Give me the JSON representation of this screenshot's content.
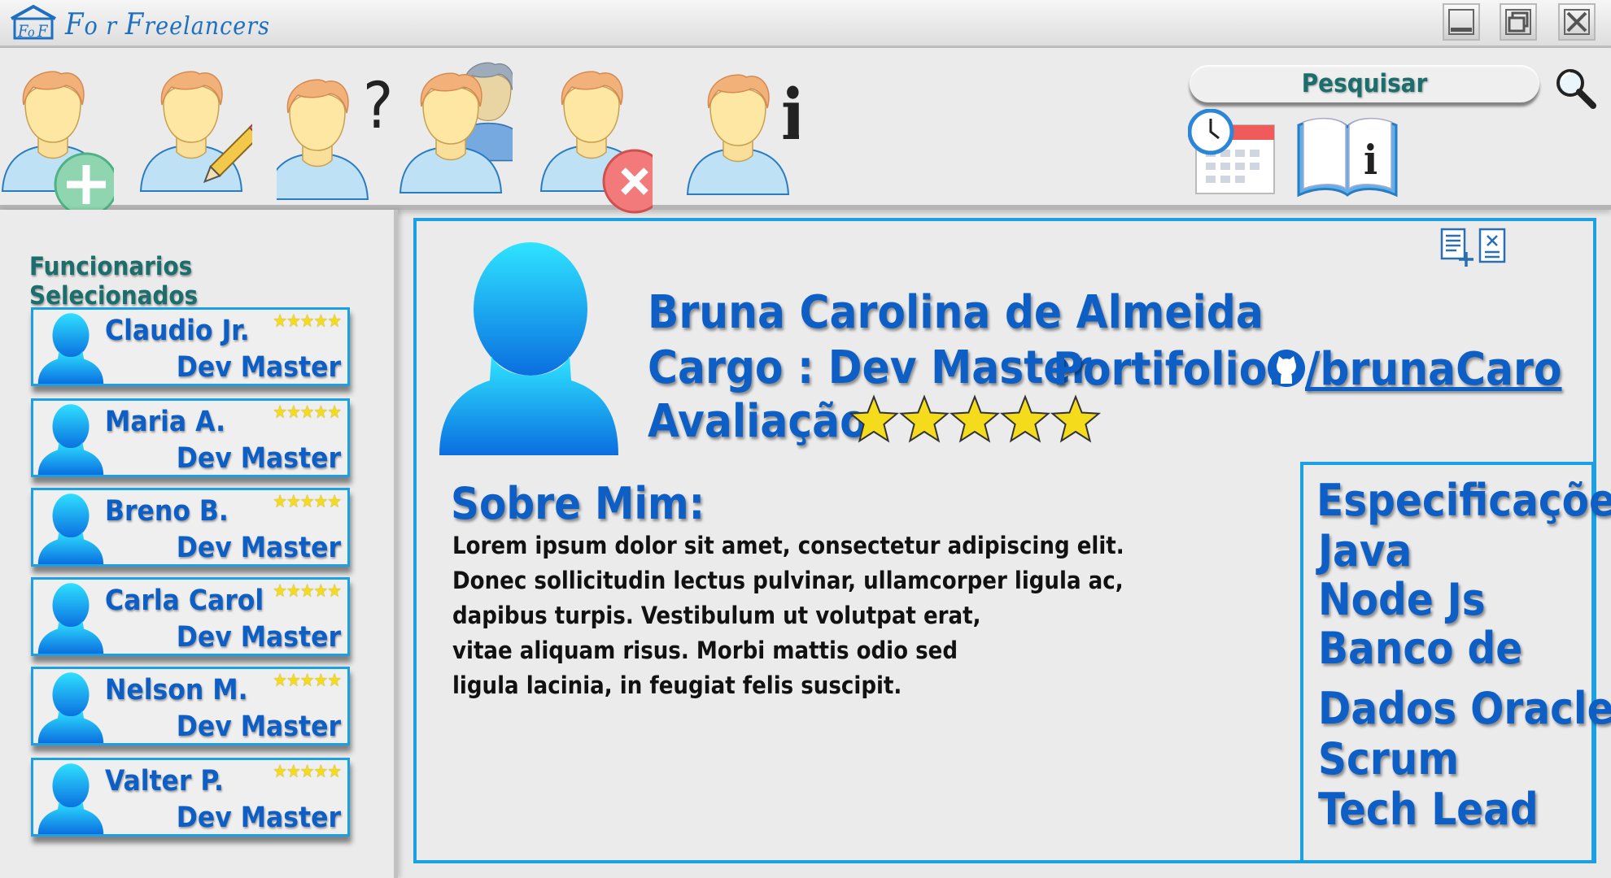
{
  "app": {
    "title_first": "F",
    "title_o": "o",
    "title_r": " r ",
    "title_second": "F",
    "title_rest": "reelancers"
  },
  "window_controls": [
    "minimize",
    "maximize",
    "close"
  ],
  "toolbar": {
    "tools": [
      {
        "name": "add-employee",
        "icon": "user-plus-icon"
      },
      {
        "name": "edit-employee",
        "icon": "user-edit-icon"
      },
      {
        "name": "query-employee",
        "icon": "user-question-icon",
        "glyph": "?"
      },
      {
        "name": "employee-group",
        "icon": "users-group-icon"
      },
      {
        "name": "remove-employee",
        "icon": "user-remove-icon"
      },
      {
        "name": "employee-info",
        "icon": "user-info-icon",
        "glyph": "i"
      }
    ],
    "search_placeholder": "Pesquisar",
    "calendar_icon": "calendar-clock-icon",
    "manual_icon": "book-info-icon"
  },
  "sidebar": {
    "title": "Funcionarios Selecionados",
    "stars": "★★★★★",
    "employees": [
      {
        "name": "Claudio Jr.",
        "role": "Dev Master"
      },
      {
        "name": "Maria A.",
        "role": "Dev Master"
      },
      {
        "name": "Breno B.",
        "role": "Dev Master"
      },
      {
        "name": "Carla Carol",
        "role": "Dev Master"
      },
      {
        "name": "Nelson M.",
        "role": "Dev Master"
      },
      {
        "name": "Valter P.",
        "role": "Dev Master"
      }
    ]
  },
  "profile": {
    "name": "Bruna Carolina de Almeida",
    "cargo_label": "Cargo : Dev Master",
    "portfolio_label": "Portifolio:",
    "portfolio_link": "/brunaCaro",
    "rating_label": "Avaliação",
    "rating_value": 5,
    "about_title": "Sobre Mim:",
    "about_lines": [
      "Lorem ipsum dolor sit amet, consectetur adipiscing elit.",
      "Donec sollicitudin lectus pulvinar, ullamcorper ligula ac,",
      "dapibus turpis. Vestibulum ut volutpat erat,",
      "vitae aliquam risus. Morbi mattis odio sed",
      "ligula lacinia, in feugiat felis suscipit."
    ],
    "specs_title": "Especificações",
    "specs": [
      "Java",
      "Node Js",
      "Banco de",
      "Dados Oracle",
      "Scrum",
      "Tech Lead"
    ]
  },
  "colors": {
    "accent_blue": "#1aa0e3",
    "text_blue": "#0d5fc5",
    "teal": "#1b6e6b",
    "star_yellow": "#f4dc1c"
  }
}
